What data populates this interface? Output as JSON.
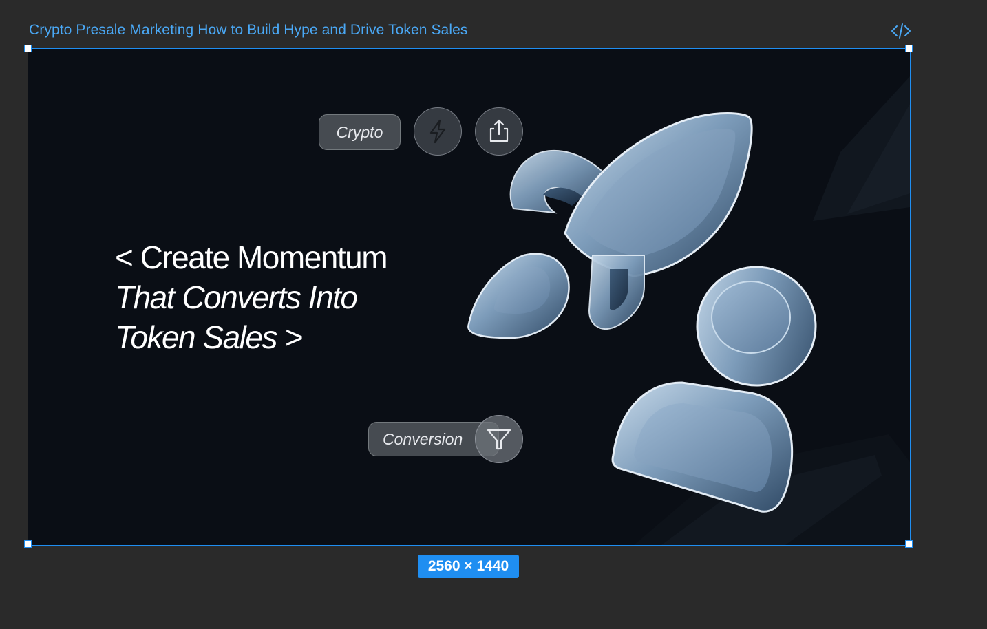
{
  "frame": {
    "title": "Crypto Presale Marketing How to Build Hype and Drive Token Sales",
    "dimensions_label": "2560 × 1440",
    "selection_color": "#1f8ef1"
  },
  "toolbar": {
    "code_icon": "code-brackets-icon"
  },
  "artwork": {
    "background": "#0a0e15",
    "headline": {
      "line1": "< Create Momentum",
      "line2": "That Converts Into",
      "line3": "Token Sales >"
    },
    "tags": {
      "crypto_label": "Crypto",
      "conversion_label": "Conversion"
    },
    "icons": [
      "lightning-icon",
      "share-upload-icon",
      "funnel-filter-icon",
      "rocket-illustration"
    ]
  }
}
